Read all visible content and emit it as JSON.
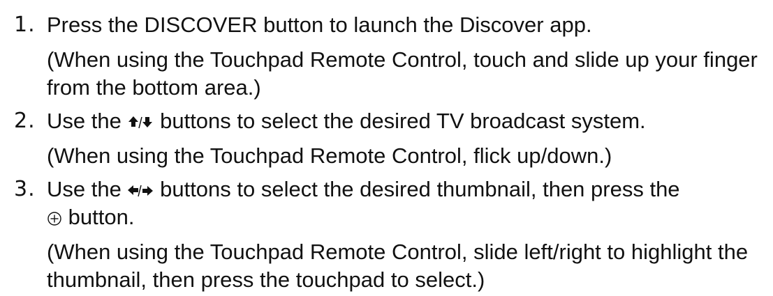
{
  "steps": [
    {
      "number": "1.",
      "text": "Press the DISCOVER button to launch the Discover app.",
      "note": "(When using the Touchpad Remote Control, touch and slide up your finger from the bottom area.)"
    },
    {
      "number": "2.",
      "text_before": "Use the",
      "icon": "up-down-arrow-icon",
      "text_after": "buttons to select the desired TV broadcast system.",
      "note": "(When using the Touchpad Remote Control, flick up/down.)"
    },
    {
      "number": "3.",
      "text_before": "Use the",
      "icon": "left-right-arrow-icon",
      "text_after": "buttons to select the desired thumbnail, then press the",
      "icon2": "enter-circle-icon",
      "text_end": "button.",
      "note": "(When using the Touchpad Remote Control, slide left/right to highlight the thumbnail, then press the touchpad to select.)"
    }
  ]
}
